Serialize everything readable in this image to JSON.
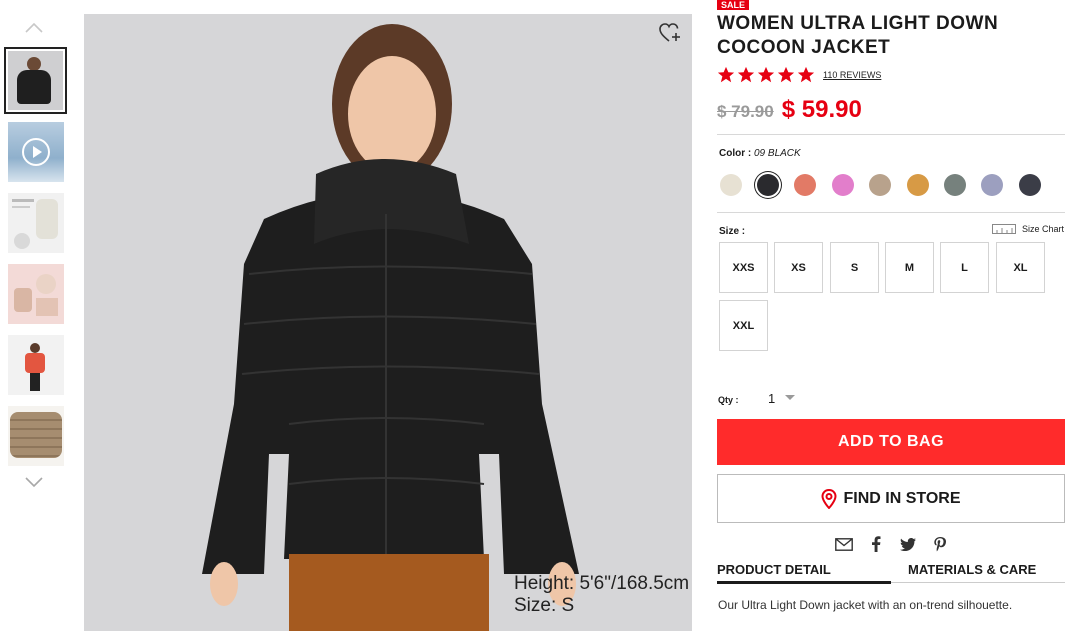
{
  "product": {
    "sale_badge": "SALE",
    "title": "WOMEN ULTRA LIGHT DOWN COCOON JACKET",
    "rating": 5,
    "reviews_label": "110 REVIEWS",
    "old_price": "$ 79.90",
    "new_price": "$ 59.90",
    "color_label": "Color :",
    "color_value": "09 BLACK",
    "size_label": "Size :",
    "size_chart_label": "Size Chart",
    "sizes": [
      "XXS",
      "XS",
      "S",
      "M",
      "L",
      "XL",
      "XXL"
    ],
    "qty_label": "Qty :",
    "qty_value": "1",
    "add_to_bag": "ADD TO BAG",
    "find_in_store": "FIND IN STORE",
    "tabs": [
      "PRODUCT DETAIL",
      "MATERIALS & CARE"
    ],
    "active_tab": "PRODUCT DETAIL",
    "description": "Our Ultra Light Down jacket with an on-trend silhouette."
  },
  "image_caption": {
    "height": "Height: 5'6\"/168.5cm",
    "size": "Size: S"
  },
  "colors": {
    "accent_red": "#e60012",
    "button_red": "#ff2b2b",
    "swatches": [
      "#e7e1d3",
      "#2a2a2e",
      "#e27a66",
      "#e27ecb",
      "#b8a28c",
      "#d79a45",
      "#76817d",
      "#9c9fbf",
      "#3b3d47"
    ],
    "selected_swatch_index": 1
  },
  "icons": {
    "thumb_up": "chevron-up-icon",
    "thumb_down": "chevron-down-icon",
    "wishlist": "heart-plus-icon",
    "share": [
      "email-icon",
      "facebook-icon",
      "twitter-icon",
      "pinterest-icon"
    ]
  }
}
